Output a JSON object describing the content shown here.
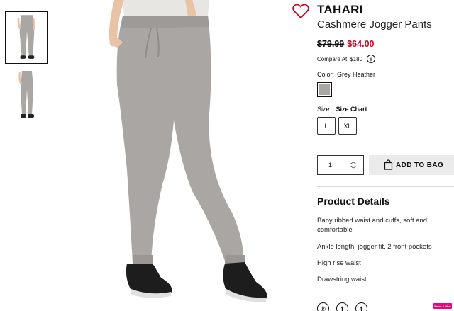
{
  "product": {
    "brand": "TAHARI",
    "name": "Cashmere Jogger Pants",
    "price_original": "$79.99",
    "price_sale": "$64.00",
    "compare_label": "Compare At",
    "compare_value": "$180",
    "info_icon_glyph": "i"
  },
  "color": {
    "label": "Color:",
    "value": "Grey Heather",
    "swatch_hex": "#a9a6a3"
  },
  "size": {
    "label": "Size",
    "chart_link": "Size Chart",
    "options": [
      "L",
      "XL"
    ]
  },
  "cart": {
    "quantity": "1",
    "up_glyph": "︿",
    "down_glyph": "﹀",
    "add_label": "ADD TO BAG"
  },
  "details": {
    "title": "Product Details",
    "items": [
      "Baby ribbed waist and cuffs, soft and comfortable",
      "Ankle length, jogger fit, 2 front pockets",
      "High rise waist",
      "Drawstring waist"
    ]
  },
  "social": {
    "pinterest_glyph": "℗",
    "facebook_glyph": "f",
    "twitter_glyph": "t"
  },
  "badge": {
    "label": "Point & Vibe"
  },
  "colors": {
    "sale": "#d0021b",
    "heart": "#d0021b",
    "badge": "#e3087c",
    "pants": "#a9a6a3"
  },
  "icons": [
    "heart-icon",
    "info-icon",
    "bag-icon",
    "chevron-up-icon",
    "chevron-down-icon",
    "pinterest-icon",
    "facebook-icon",
    "twitter-icon"
  ]
}
